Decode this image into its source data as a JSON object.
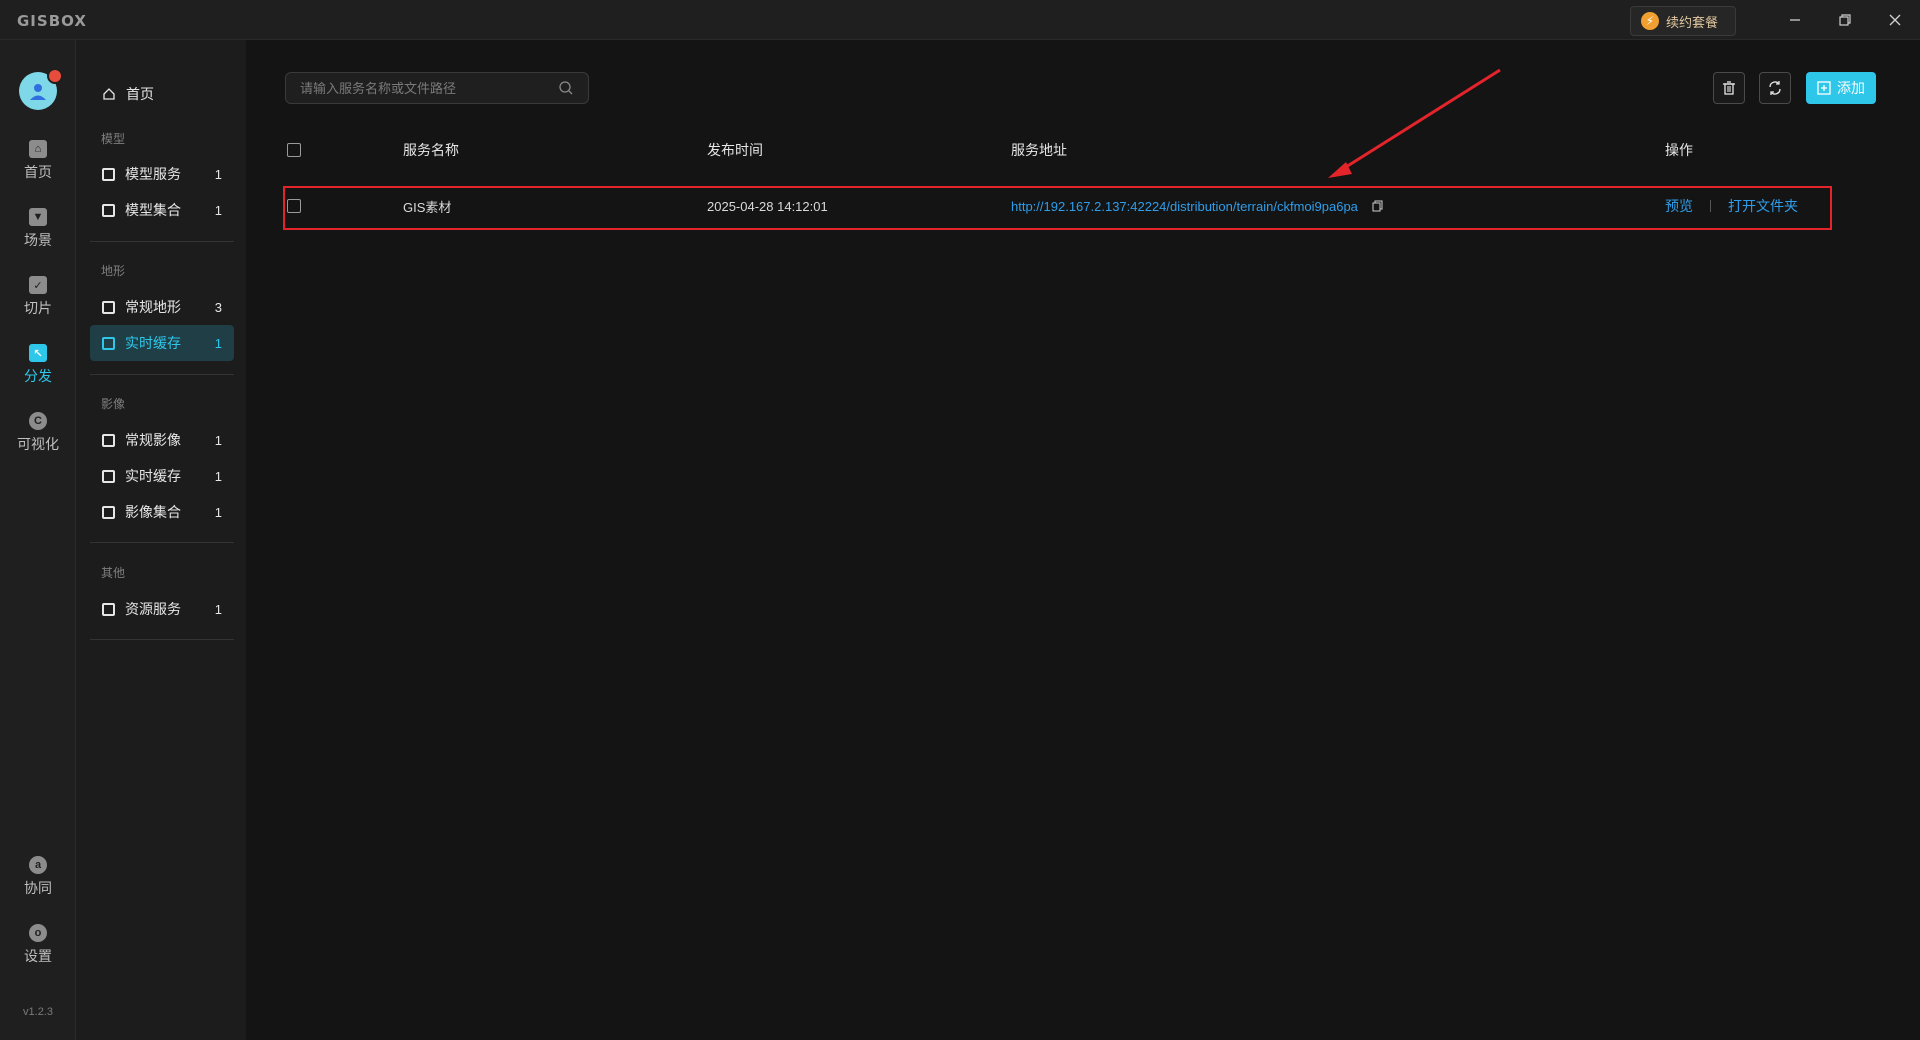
{
  "app": {
    "logo": "GISBOX",
    "renew_label": "续约套餐",
    "version": "v1.2.3"
  },
  "rail": {
    "items": [
      {
        "label": "首页",
        "icon": "home-icon"
      },
      {
        "label": "场景",
        "icon": "scene-icon"
      },
      {
        "label": "切片",
        "icon": "tile-icon"
      },
      {
        "label": "分发",
        "icon": "distribute-icon"
      },
      {
        "label": "可视化",
        "icon": "visualize-icon"
      },
      {
        "label": "协同",
        "icon": "collab-icon"
      },
      {
        "label": "设置",
        "icon": "settings-icon"
      }
    ],
    "active": "分发"
  },
  "sidebar": {
    "home": "首页",
    "groups": {
      "model": "模型",
      "terrain": "地形",
      "imagery": "影像",
      "other": "其他"
    },
    "items": {
      "model_service": {
        "label": "模型服务",
        "count": "1"
      },
      "model_collection": {
        "label": "模型集合",
        "count": "1"
      },
      "terrain_regular": {
        "label": "常规地形",
        "count": "3"
      },
      "terrain_realtime": {
        "label": "实时缓存",
        "count": "1"
      },
      "imagery_regular": {
        "label": "常规影像",
        "count": "1"
      },
      "imagery_realtime": {
        "label": "实时缓存",
        "count": "1"
      },
      "imagery_collection": {
        "label": "影像集合",
        "count": "1"
      },
      "resource_service": {
        "label": "资源服务",
        "count": "1"
      }
    }
  },
  "toolbar": {
    "search_placeholder": "请输入服务名称或文件路径",
    "add_label": "添加"
  },
  "table": {
    "columns": [
      "服务名称",
      "发布时间",
      "服务地址",
      "操作"
    ],
    "rows": [
      {
        "name": "GIS素材",
        "time": "2025-04-28 14:12:01",
        "url": "http://192.167.2.137:42224/distribution/terrain/ckfmoi9pa6pa",
        "action_preview": "预览",
        "action_open": "打开文件夹"
      }
    ]
  },
  "colors": {
    "accent": "#2ec7ea",
    "link": "#2f9eea",
    "annotation": "#e3242b"
  }
}
